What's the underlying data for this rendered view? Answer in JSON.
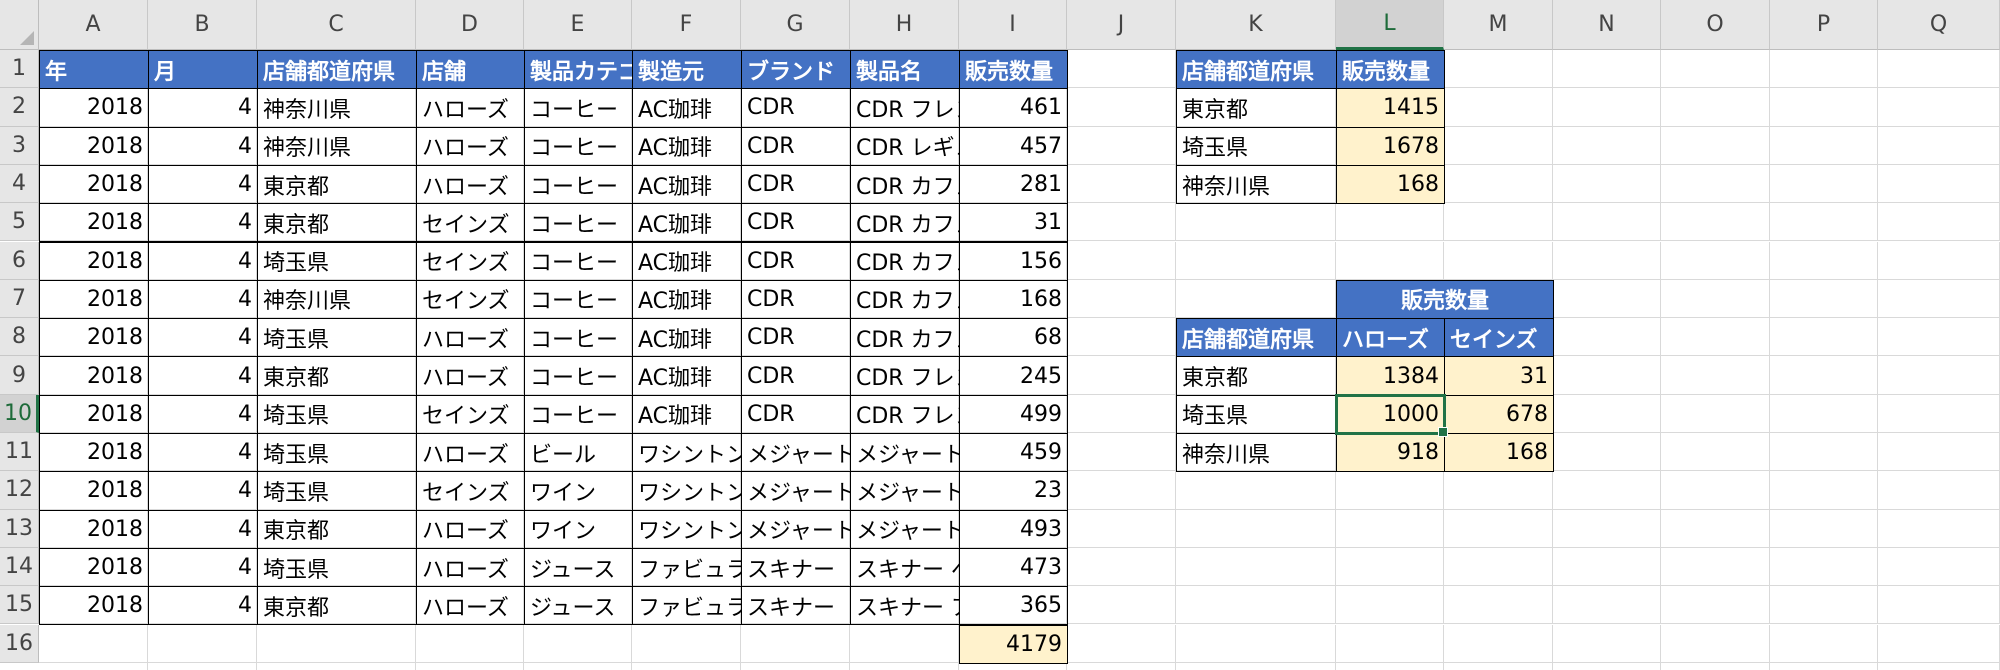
{
  "columns": [
    "A",
    "B",
    "C",
    "D",
    "E",
    "F",
    "G",
    "H",
    "I",
    "J",
    "K",
    "L",
    "M",
    "N",
    "O",
    "P",
    "Q"
  ],
  "rows": [
    "1",
    "2",
    "3",
    "4",
    "5",
    "6",
    "7",
    "8",
    "9",
    "10",
    "11",
    "12",
    "13",
    "14",
    "15",
    "16"
  ],
  "selected": {
    "col": "L",
    "row": "10"
  },
  "table": {
    "headers": [
      "年",
      "月",
      "店舗都道府県",
      "店舗",
      "製品カテゴリ",
      "製造元",
      "ブランド",
      "製品名",
      "販売数量"
    ],
    "rows": [
      [
        "2018",
        "4",
        "神奈川県",
        "ハローズ",
        "コーヒー",
        "AC珈琲",
        "CDR",
        "CDR フレンチ",
        "461"
      ],
      [
        "2018",
        "4",
        "神奈川県",
        "ハローズ",
        "コーヒー",
        "AC珈琲",
        "CDR",
        "CDR レギュラー",
        "457"
      ],
      [
        "2018",
        "4",
        "東京都",
        "ハローズ",
        "コーヒー",
        "AC珈琲",
        "CDR",
        "CDR カフェイン",
        "281"
      ],
      [
        "2018",
        "4",
        "東京都",
        "セインズ",
        "コーヒー",
        "AC珈琲",
        "CDR",
        "CDR カフェイン",
        "31"
      ],
      [
        "2018",
        "4",
        "埼玉県",
        "セインズ",
        "コーヒー",
        "AC珈琲",
        "CDR",
        "CDR カフェイン",
        "156"
      ],
      [
        "2018",
        "4",
        "神奈川県",
        "セインズ",
        "コーヒー",
        "AC珈琲",
        "CDR",
        "CDR カフェイン",
        "168"
      ],
      [
        "2018",
        "4",
        "埼玉県",
        "ハローズ",
        "コーヒー",
        "AC珈琲",
        "CDR",
        "CDR カフェイン",
        "68"
      ],
      [
        "2018",
        "4",
        "東京都",
        "ハローズ",
        "コーヒー",
        "AC珈琲",
        "CDR",
        "CDR フレンチ",
        "245"
      ],
      [
        "2018",
        "4",
        "埼玉県",
        "セインズ",
        "コーヒー",
        "AC珈琲",
        "CDR",
        "CDR フレンチ",
        "499"
      ],
      [
        "2018",
        "4",
        "埼玉県",
        "ハローズ",
        "ビール",
        "ワシントンビール",
        "メジャートップ",
        "メジャートップ",
        "459"
      ],
      [
        "2018",
        "4",
        "埼玉県",
        "セインズ",
        "ワイン",
        "ワシントンビール",
        "メジャートップ",
        "メジャートップ",
        "23"
      ],
      [
        "2018",
        "4",
        "東京都",
        "ハローズ",
        "ワイン",
        "ワシントンビール",
        "メジャートップ",
        "メジャートップ",
        "493"
      ],
      [
        "2018",
        "4",
        "埼玉県",
        "ハローズ",
        "ジュース",
        "ファビュラス飲料",
        "スキナー",
        "スキナー ベリー",
        "473"
      ],
      [
        "2018",
        "4",
        "東京都",
        "ハローズ",
        "ジュース",
        "ファビュラス飲料",
        "スキナー",
        "スキナー アップル",
        "365"
      ]
    ],
    "total": "4179"
  },
  "summary1": {
    "headers": [
      "店舗都道府県",
      "販売数量"
    ],
    "rows": [
      [
        "東京都",
        "1415"
      ],
      [
        "埼玉県",
        "1678"
      ],
      [
        "神奈川県",
        "168"
      ]
    ]
  },
  "summary2": {
    "title": "販売数量",
    "headers": [
      "店舗都道府県",
      "ハローズ",
      "セインズ"
    ],
    "rows": [
      [
        "東京都",
        "1384",
        "31"
      ],
      [
        "埼玉県",
        "1000",
        "678"
      ],
      [
        "神奈川県",
        "918",
        "168"
      ]
    ]
  }
}
